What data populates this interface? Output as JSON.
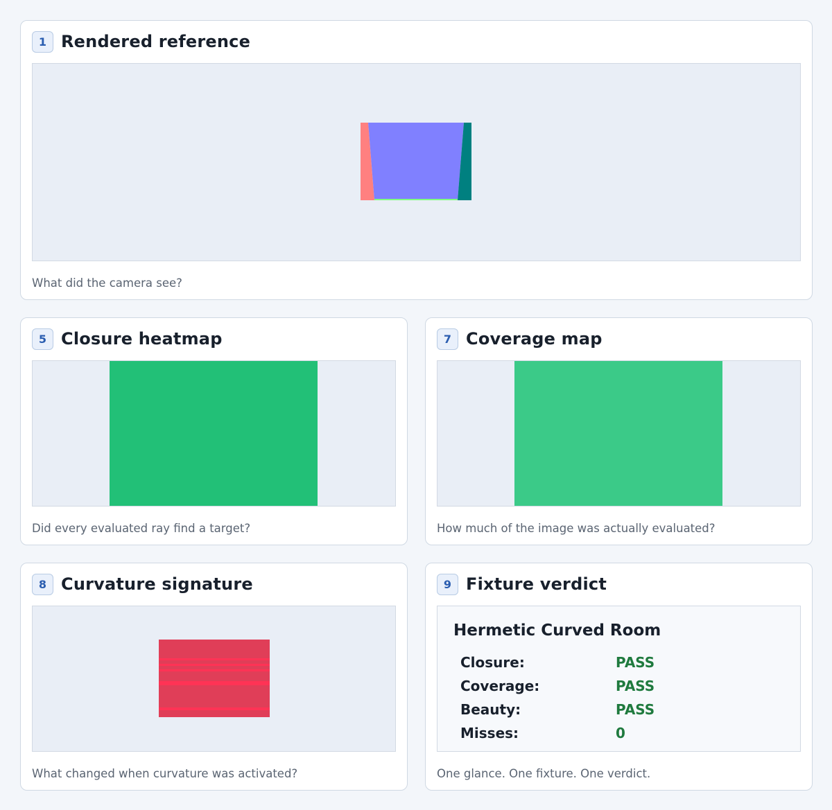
{
  "cards": {
    "reference": {
      "number": "1",
      "title": "Rendered reference",
      "caption": "What did the camera see?"
    },
    "closure": {
      "number": "5",
      "title": "Closure heatmap",
      "caption": "Did every evaluated ray find a target?"
    },
    "coverage": {
      "number": "7",
      "title": "Coverage map",
      "caption": "How much of the image was actually evaluated?"
    },
    "curvature": {
      "number": "8",
      "title": "Curvature signature",
      "caption": "What changed when curvature was activated?"
    },
    "verdict": {
      "number": "9",
      "title": "Fixture verdict",
      "caption": "One glance. One fixture. One verdict."
    }
  },
  "verdict": {
    "fixture_name": "Hermetic Curved Room",
    "rows": [
      {
        "label": "Closure:",
        "value": "PASS"
      },
      {
        "label": "Coverage:",
        "value": "PASS"
      },
      {
        "label": "Beauty:",
        "value": "PASS"
      },
      {
        "label": "Misses:",
        "value": "0"
      }
    ]
  },
  "colors": {
    "panel_bg": "#e9eef6",
    "reference_center": "#8080ff",
    "reference_left": "#ff8080",
    "reference_right": "#008080",
    "reference_floor": "#80ff80",
    "closure_fill": "#22c077",
    "coverage_fill": "#3bca88",
    "curvature_fill": "#e03e58",
    "curvature_stripe": "#ff3355",
    "pass_text": "#1f7a3e"
  }
}
